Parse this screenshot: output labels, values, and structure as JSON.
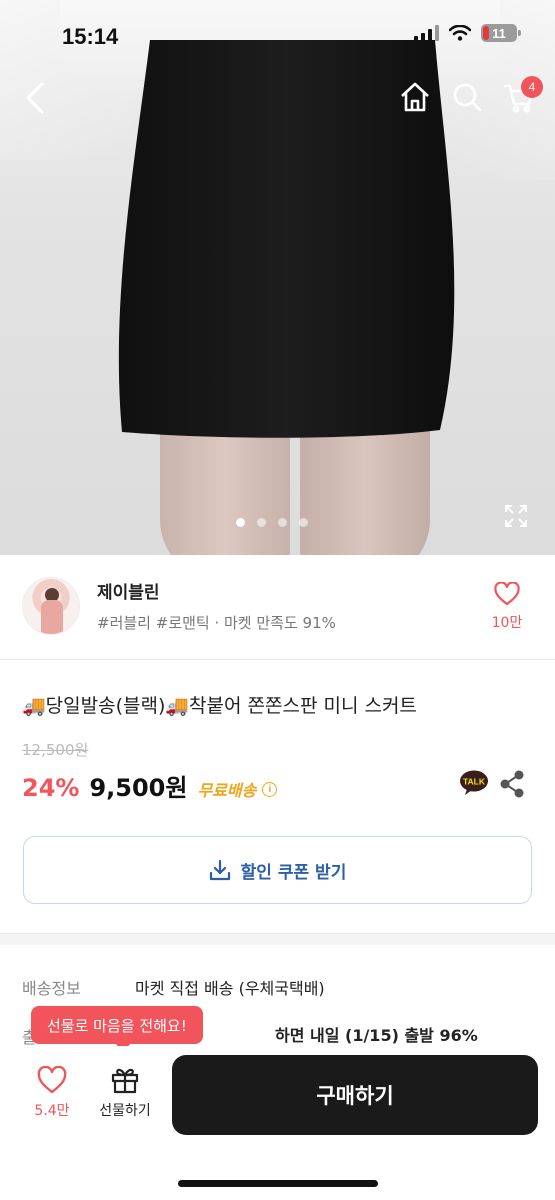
{
  "status_bar": {
    "time": "15:14",
    "battery": "11"
  },
  "nav": {
    "cart_count": "4"
  },
  "gallery": {
    "dots": 4,
    "active_index": 0
  },
  "shop": {
    "name": "제이블린",
    "tags": "#러블리 #로맨틱 · 마켓 만족도 91%",
    "likes": "10만"
  },
  "product": {
    "title": "🚚당일발송(블랙)🚚착붙어 쫀쫀스판 미니 스커트",
    "original_price": "12,500원",
    "discount": "24%",
    "price": "9,500원",
    "free_shipping": "무료배송",
    "talk_label": "TALK"
  },
  "coupon": {
    "label": "할인 쿠폰 받기"
  },
  "shipping": {
    "label": "배송정보",
    "value": "마켓 직접 배송 (우체국택배)",
    "label2": "출",
    "value2": "하면 내일 (1/15) 출발 96%"
  },
  "tooltip": {
    "text": "선물로 마음을 전해요!"
  },
  "bottom_bar": {
    "like_count": "5.4만",
    "gift_label": "선물하기",
    "buy_label": "구매하기"
  },
  "colors": {
    "accent": "#f2545b",
    "free_ship": "#f0a51a",
    "coupon": "#2b5fa8",
    "buy_button": "#1a1a1a"
  }
}
